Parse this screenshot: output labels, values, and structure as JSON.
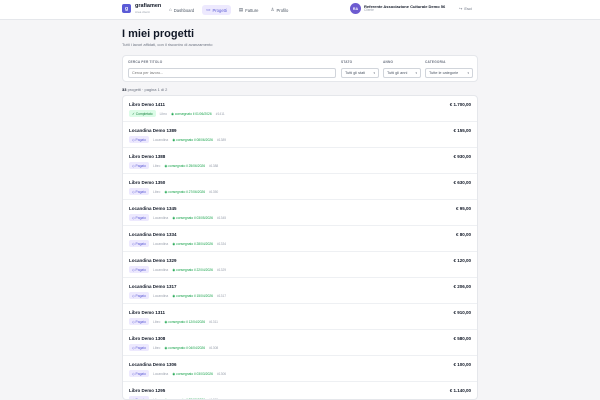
{
  "app": {
    "brand_name": "grafiamen",
    "brand_sub": "Area clienti",
    "brand_logo_letter": "g"
  },
  "nav": {
    "items": [
      {
        "label": "Dashboard",
        "icon": "home-icon"
      },
      {
        "label": "Progetti",
        "icon": "folder-icon",
        "active": true
      },
      {
        "label": "Fatture",
        "icon": "invoice-icon"
      },
      {
        "label": "Profilo",
        "icon": "user-icon"
      }
    ]
  },
  "account": {
    "initials": "RA",
    "name": "Referente Associazione Culturale Demo 56",
    "role": "Cliente",
    "logout_label": "Esci"
  },
  "page": {
    "title": "I miei progetti",
    "subtitle": "Tutti i lavori affidati, con il riscontro di avanzamento"
  },
  "filters": {
    "search_label": "CERCA PER TITOLO",
    "search_placeholder": "Cerca per lavoro...",
    "stato_label": "STATO",
    "stato_value": "Tutti gli stati",
    "anno_label": "ANNO",
    "anno_value": "Tutti gli anni",
    "categoria_label": "CATEGORIA",
    "categoria_value": "Tutte le categorie"
  },
  "summary": {
    "count": "33",
    "count_suffix": "progetti · pagina 1 di 2"
  },
  "colors": {
    "accent": "#5b5bd6",
    "paid_badge_bg": "#ede9fe",
    "completed_badge_bg": "#dcfce7",
    "delivery_green": "#16a34a"
  },
  "projects": [
    {
      "title": "Libro Demo 1411",
      "price": "€ 1.700,00",
      "status": "Completato",
      "status_kind": "completato",
      "type": "Libro",
      "delivery": "consegnato il 01/06/2026",
      "id": "#1411"
    },
    {
      "title": "Locandina Demo 1389",
      "price": "€ 155,00",
      "status": "Pagato",
      "status_kind": "pagato",
      "type": "Locandina",
      "delivery": "consegnato il 08/06/2026",
      "id": "#1389"
    },
    {
      "title": "Libro Demo 1388",
      "price": "€ 930,00",
      "status": "Pagato",
      "status_kind": "pagato",
      "type": "Libro",
      "delivery": "consegnato il 25/06/2026",
      "id": "#1388"
    },
    {
      "title": "Libro Demo 1350",
      "price": "€ 630,00",
      "status": "Pagato",
      "status_kind": "pagato",
      "type": "Libro",
      "delivery": "consegnato il 27/06/2026",
      "id": "#1350"
    },
    {
      "title": "Locandina Demo 1345",
      "price": "€ 95,00",
      "status": "Pagato",
      "status_kind": "pagato",
      "type": "Locandina",
      "delivery": "consegnato il 03/05/2026",
      "id": "#1345"
    },
    {
      "title": "Locandina Demo 1334",
      "price": "€ 80,00",
      "status": "Pagato",
      "status_kind": "pagato",
      "type": "Locandina",
      "delivery": "consegnato il 28/04/2026",
      "id": "#1334"
    },
    {
      "title": "Locandina Demo 1329",
      "price": "€ 120,00",
      "status": "Pagato",
      "status_kind": "pagato",
      "type": "Locandina",
      "delivery": "consegnato il 22/04/2026",
      "id": "#1329"
    },
    {
      "title": "Locandina Demo 1317",
      "price": "€ 206,00",
      "status": "Pagato",
      "status_kind": "pagato",
      "type": "Locandina",
      "delivery": "consegnato il 15/04/2026",
      "id": "#1317"
    },
    {
      "title": "Libro Demo 1311",
      "price": "€ 910,00",
      "status": "Pagato",
      "status_kind": "pagato",
      "type": "Libro",
      "delivery": "consegnato il 12/04/2026",
      "id": "#1311"
    },
    {
      "title": "Libro Demo 1308",
      "price": "€ 580,00",
      "status": "Pagato",
      "status_kind": "pagato",
      "type": "Libro",
      "delivery": "consegnato il 04/04/2026",
      "id": "#1308"
    },
    {
      "title": "Locandina Demo 1306",
      "price": "€ 100,00",
      "status": "Pagato",
      "status_kind": "pagato",
      "type": "Locandina",
      "delivery": "consegnato il 03/03/2026",
      "id": "#1306"
    },
    {
      "title": "Libro Demo 1295",
      "price": "€ 1.140,00",
      "status": "Pagato",
      "status_kind": "pagato",
      "type": "Libro",
      "delivery": "consegnato il 28/03/2026",
      "id": "#1295"
    }
  ]
}
